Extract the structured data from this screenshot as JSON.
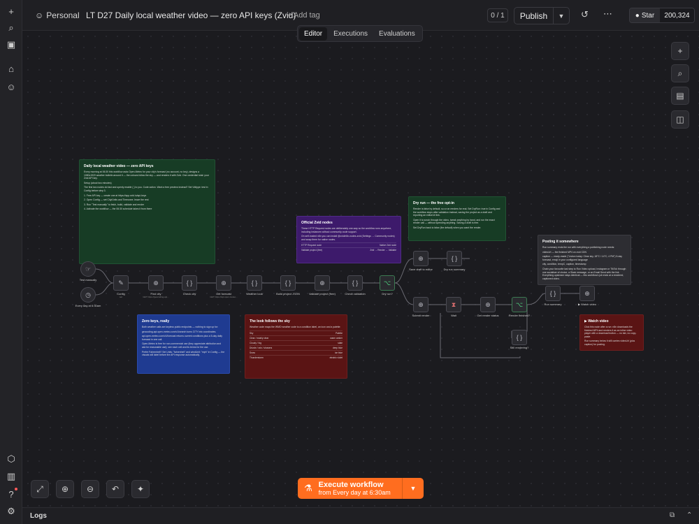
{
  "header": {
    "project": "Personal",
    "title": "LT D27 Daily local weather video — zero API keys (Zvid)",
    "add_tag": "+ Add tag",
    "counter": "0 / 1",
    "publish": "Publish",
    "github_star": "Star",
    "github_count": "200,324"
  },
  "tabs": [
    {
      "label": "Editor",
      "active": true
    },
    {
      "label": "Executions",
      "active": false
    },
    {
      "label": "Evaluations",
      "active": false
    }
  ],
  "execute": {
    "label": "Execute workflow",
    "sub": "from Every day at 6:30am"
  },
  "logs": {
    "label": "Logs"
  },
  "stickies": {
    "main": {
      "title": "Daily local weather video — zero API keys",
      "lines": [
        "Every morning at 06:30 this workflow asks Open-Meteo for your city's forecast (no account, no key), designs a 1080x1920 weather bulletin around it — the colours follow the sky — and renders it with Zvid. One credential total: your Zvid API key.",
        "Setup (about two minutes)",
        "The first two nodes do fast and openly enable { } to you. Code action. Want a free preview instead? Set Vidtype: test in Config before step 3.",
        "1. Free API key — create one at https://app.zvid.io/api-keys",
        "2. Open Config — set City/Units and Timezone; leave the rest",
        "3. Run \"Test manually\" to fetch, build, validate and render",
        "4. Activate the workflow — the 06:30 schedule takes it from there"
      ]
    },
    "zvid": {
      "title": "Official Zvid nodes",
      "lines": [
        "These HTTP Request nodes are deliberately one-way so the workflow runs anywhere, including instances without community-node support.",
        "On self-hosted n8n you can install @zvid/n8n-nodes-zvid (Settings → Community nodes) and swap them for native nodes."
      ],
      "rows": [
        [
          "HTTP Request node",
          "Native Zvid node"
        ],
        [
          "Validate project (free)",
          "Zvid → Render → Validate"
        ]
      ]
    },
    "dry": {
      "title": "Dry run — the free opt-in",
      "lines": [
        "Render is false by default, so a run renders for real. Set DryRun: true in Config and the workflow stops after validation instead, saving the project as a draft and reporting an editorUrl link.",
        "Open it to scrub through the video, tweak anything by hand, and run the exact render call — without spending anything. Saving a draft is free.",
        "Set DryRun back to false (the default) when you want the render."
      ]
    },
    "keys": {
      "title": "Zero keys, really",
      "lines": [
        "Both weather calls are keyless public endpoints — nothing to sign up for:",
        "geocoding-api.open-meteo.com/v1/search turns CITY into coordinates.",
        "api.open-meteo.com/v1/forecast returns current conditions plus a 5-day daily forecast in one call.",
        "Open-Meteo is free for non-commercial use (they appreciate attribution and ask for reasonable use); see each cell and its terms for the use.",
        "Prefer Fahrenheit? Set Units: \"fahrenheit\" and windUnit: \"mph\" in Config — the visuals will label before the API response automatically."
      ]
    },
    "sky": {
      "title": "The look follows the sky",
      "lines": [
        "Weather code maps the WMO weather code to a condition label, an icon and a palette:"
      ],
      "rows": [
        [
          "Sky",
          "Palette"
        ],
        [
          "Clear / mainly clear",
          "warm amber"
        ],
        [
          "Cloudy / fog",
          "slate"
        ],
        [
          "Drizzle / rain / showers",
          "deep blue"
        ],
        [
          "Snow",
          "ice blue"
        ],
        [
          "Thunderstorm",
          "electric violet"
        ]
      ]
    },
    "posting": {
      "title": "Posting it somewhere",
      "lines": [
        "Run summary ends the run with everything a publishing node needs:",
        "videoUrl — the finished MP4 on zvid CDN",
        "caption — ready-made (\"Lisbon today: Clear sky, 18°C / 14°C, 4 PM\") 5-day forecast, emoji in your configured language",
        "city, condition, tempC, caption, timestamp",
        "Chain your favourite last step to Run Video upload, Instagram or TikTok through one socialiser of choice, a Slack message, or an Email Send with the link. Everything upstream stays identical — this workflow's job ends at a rendered, captioned video."
      ]
    },
    "watch": {
      "title": "▶ Watch video",
      "lines": [
        "Click this node after a run: n8n downloads the finished MP4 and renders it as an inline video player with a download button — no tab, no copy-paste.",
        "Run summary below it still carries videoUrl (plus caption) for posting."
      ]
    }
  },
  "nodes": [
    {
      "id": "test",
      "label": "Test manually",
      "icon": "☞"
    },
    {
      "id": "daily",
      "label": "Every day at 6:30am",
      "icon": "◷"
    },
    {
      "id": "config",
      "label": "Config",
      "sub": "set",
      "icon": "✎"
    },
    {
      "id": "find",
      "label": "Find city",
      "sub": "GET https://geocoding-api...",
      "icon": "⊕"
    },
    {
      "id": "check",
      "label": "Check city",
      "icon": "{ }"
    },
    {
      "id": "getforecast",
      "label": "Get forecast",
      "sub": "GET https://api.open-meteo...",
      "icon": "⊕"
    },
    {
      "id": "wlook",
      "label": "Weather look",
      "icon": "{ }"
    },
    {
      "id": "build",
      "label": "Build project JSON",
      "icon": "{ }"
    },
    {
      "id": "validate",
      "label": "Validate project (free)",
      "icon": "⊕"
    },
    {
      "id": "checkval",
      "label": "Check validation",
      "icon": "{ }"
    },
    {
      "id": "dryq",
      "label": "Dry run?",
      "icon": "⌥"
    },
    {
      "id": "savedraft",
      "label": "Save draft to editor",
      "icon": "⊕"
    },
    {
      "id": "drysum",
      "label": "Dry run summary",
      "icon": "{ }"
    },
    {
      "id": "submit",
      "label": "Submit render",
      "icon": "⊕"
    },
    {
      "id": "wait",
      "label": "Wait",
      "icon": "⧗"
    },
    {
      "id": "getstatus",
      "label": "Get render status",
      "icon": "⊕"
    },
    {
      "id": "rendered",
      "label": "Render finished?",
      "icon": "⌥"
    },
    {
      "id": "stillrender",
      "label": "Still rendering?",
      "icon": "{ }"
    },
    {
      "id": "runsum",
      "label": "Run summary",
      "icon": "{ }"
    },
    {
      "id": "watch",
      "label": "▶ Watch video",
      "icon": "⊕"
    }
  ]
}
